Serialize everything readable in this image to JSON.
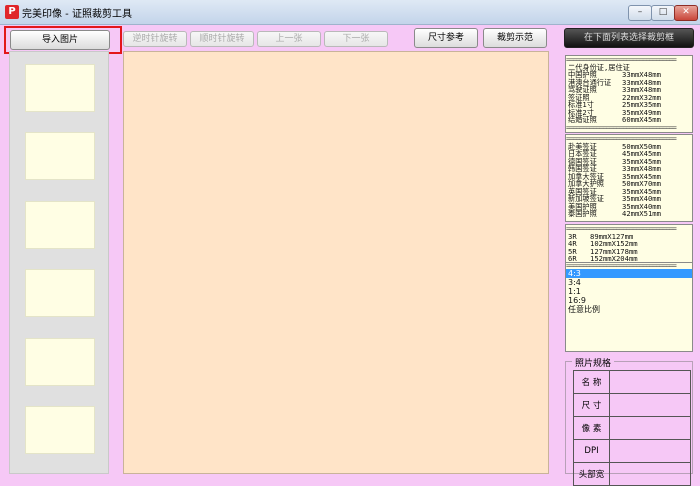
{
  "window": {
    "title": "完美印像 - 证照裁剪工具",
    "app_icon": "P",
    "controls": [
      "minimize",
      "maximize",
      "close"
    ]
  },
  "toolbar": {
    "import_label": "导入图片",
    "disabled_buttons": [
      "逆时针旋转",
      "顺时针旋转",
      "上一张",
      "下一张"
    ],
    "size_ref_label": "尺寸参考",
    "crop_demo_label": "裁剪示范",
    "select_hint": "在下面列表选择裁剪框"
  },
  "list1": {
    "header": "二代身份证,居住证",
    "rows": [
      {
        "name": "中国护照",
        "size": "33mmX48mm"
      },
      {
        "name": "港澳台通行证",
        "size": "33mmX48mm"
      },
      {
        "name": "驾驶证照",
        "size": "33mmX48mm"
      },
      {
        "name": "签证照",
        "size": "22mmX32mm"
      },
      {
        "name": "标准1寸",
        "size": "25mmX35mm"
      },
      {
        "name": "标准2寸",
        "size": "35mmX49mm"
      },
      {
        "name": "结婚证照",
        "size": "60mmX45mm"
      }
    ]
  },
  "list2": {
    "rows": [
      {
        "name": "赴美签证",
        "size": "50mmX50mm"
      },
      {
        "name": "日本签证",
        "size": "45mmX45mm"
      },
      {
        "name": "德国签证",
        "size": "35mmX45mm"
      },
      {
        "name": "韩国签证",
        "size": "33mmX48mm"
      },
      {
        "name": "加拿大签证",
        "size": "35mmX45mm"
      },
      {
        "name": "加拿大护照",
        "size": "50mmX70mm"
      },
      {
        "name": "英国签证",
        "size": "35mmX45mm"
      },
      {
        "name": "新加坡签证",
        "size": "35mmX40mm"
      },
      {
        "name": "美国护照",
        "size": "35mmX40mm"
      },
      {
        "name": "泰国护照",
        "size": "42mmX51mm"
      }
    ]
  },
  "list3": {
    "rows": [
      {
        "name": "3R",
        "size": "89mmX127mm"
      },
      {
        "name": "4R",
        "size": "102mmX152mm"
      },
      {
        "name": "5R",
        "size": "127mmX178mm"
      },
      {
        "name": "6R",
        "size": "152mmX204mm"
      }
    ]
  },
  "list4": {
    "rows": [
      "4:3",
      "3:4",
      "1:1",
      "16:9",
      "任意比例"
    ],
    "selected": "4:3"
  },
  "specs": {
    "legend": "照片规格",
    "rows": [
      "名 称",
      "尺 寸",
      "像 素",
      "DPI",
      "头部宽"
    ]
  },
  "colors": {
    "window_bg": "#f6c8f6",
    "canvas_bg": "#ffe4c8",
    "thumb_bg": "#fffee4",
    "highlight": "#e3161b",
    "selection": "#3399ff"
  }
}
